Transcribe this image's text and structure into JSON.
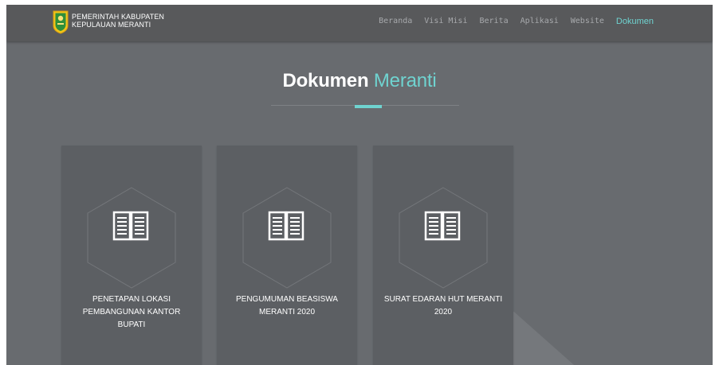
{
  "header": {
    "brand_line1": "PEMERINTAH KABUPATEN",
    "brand_line2": "KEPULAUAN MERANTI",
    "logo_icon": "regency-emblem-icon",
    "nav": [
      {
        "label": "Beranda"
      },
      {
        "label": "Visi Misi"
      },
      {
        "label": "Berita"
      },
      {
        "label": "Aplikasi"
      },
      {
        "label": "Website"
      },
      {
        "label": "Dokumen",
        "active": true
      }
    ]
  },
  "section": {
    "title_main": "Dokumen",
    "title_accent": "Meranti"
  },
  "documents": [
    {
      "title": "PENETAPAN LOKASI PEMBANGUNAN KANTOR BUPATI",
      "icon": "book-icon"
    },
    {
      "title": "PENGUMUMAN BEASISWA MERANTI 2020",
      "icon": "book-icon"
    },
    {
      "title": "SURAT EDARAN HUT MERANTI 2020",
      "icon": "book-icon"
    }
  ],
  "colors": {
    "accent": "#6fd3d0",
    "background": "#686b6f",
    "header": "#58595b",
    "card": "#5c5f63"
  }
}
